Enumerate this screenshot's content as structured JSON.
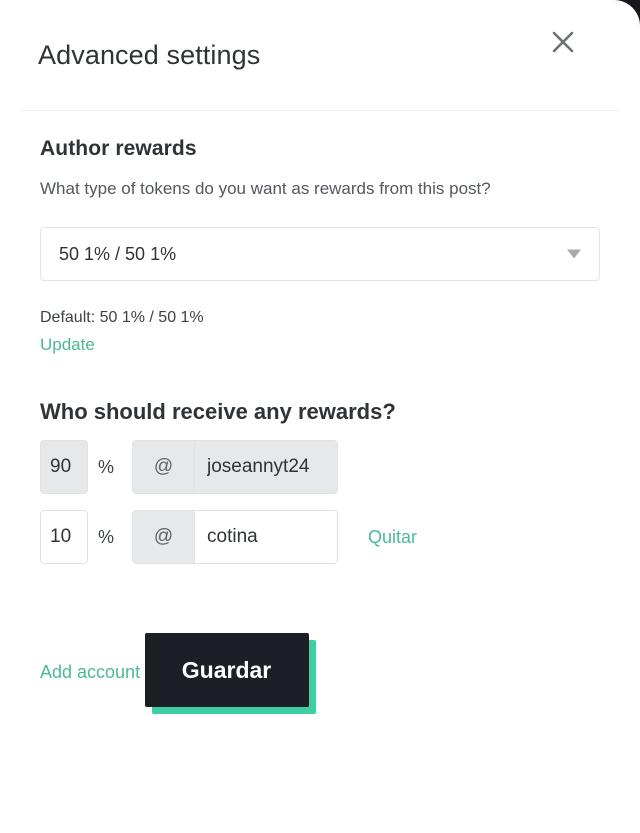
{
  "theme": {
    "accent_teal": "#3ecfa4",
    "link_teal": "#4cb999",
    "button_dark": "#1c2026",
    "text_dark": "#2f3337",
    "field_gray": "#e7e8ea"
  },
  "header": {
    "title": "Advanced settings",
    "close_icon": "close-icon"
  },
  "author_rewards": {
    "heading": "Author rewards",
    "description": "What type of tokens do you want as rewards from this post?",
    "select": {
      "value": "50 1% / 50 1%",
      "caret_icon": "chevron-down-icon"
    },
    "default_text": "Default: 50 1% / 50 1%",
    "update_link": "Update"
  },
  "beneficiaries": {
    "heading": "Who should receive any rewards?",
    "percent_symbol": "%",
    "at_symbol": "@",
    "rows": [
      {
        "percent": "90",
        "username": "joseannyt24",
        "remove_label": "",
        "editable": false
      },
      {
        "percent": "10",
        "username": "cotina",
        "remove_label": "Quitar",
        "editable": true
      }
    ],
    "add_account_link": "Add account"
  },
  "footer": {
    "save_label": "Guardar"
  }
}
